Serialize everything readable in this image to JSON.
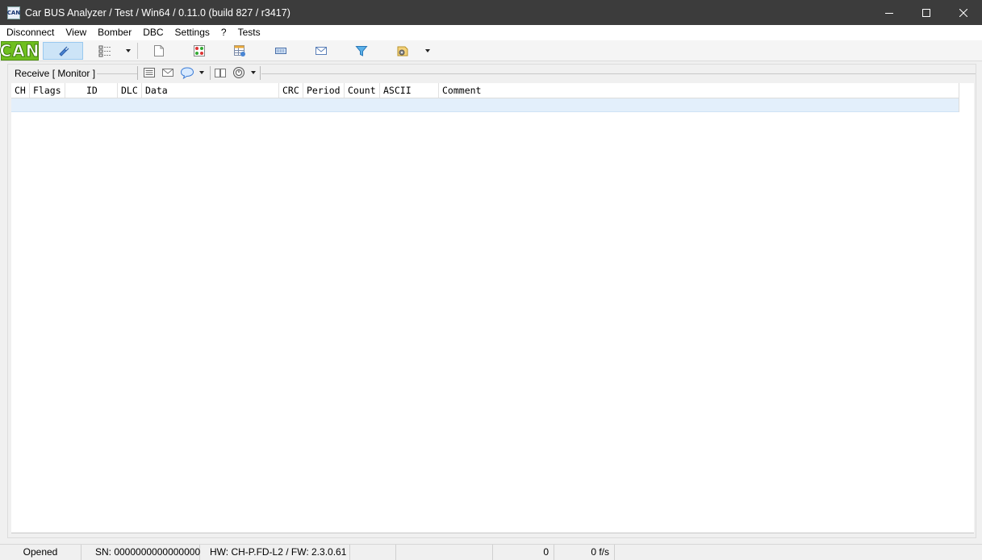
{
  "window": {
    "title": "Car BUS Analyzer / Test / Win64 / 0.11.0 (build 827 / r3417)",
    "app_icon_text": "CAN"
  },
  "menu": [
    "Disconnect",
    "View",
    "Bomber",
    "DBC",
    "Settings",
    "?",
    "Tests"
  ],
  "toolbar": {
    "logo_text": "CAN",
    "icons": [
      "connect-plug-icon",
      "tree-view-icon",
      "new-document-icon",
      "bomber-grid-icon",
      "dbc-table-icon",
      "transmit-icon",
      "message-envelope-icon",
      "filter-icon",
      "settings-icon"
    ],
    "accent": "#cce4f7",
    "logo_color": "#6fbf1f"
  },
  "receive": {
    "title": "Receive [ Monitor ]",
    "toolbar_icons": [
      "list-icon",
      "envelope-icon",
      "comment-bubble-icon",
      "book-icon",
      "clock-icon"
    ],
    "columns": [
      "CH",
      "Flags",
      "ID",
      "DLC",
      "Data",
      "CRC",
      "Period",
      "Count",
      "ASCII",
      "Comment"
    ],
    "row_color": "#e3effb"
  },
  "status": {
    "state": "Opened",
    "serial": "SN: 0000000000000000",
    "hw_fw": "HW: CH-P.FD-L2 / FW: 2.3.0.61",
    "count": "0",
    "rate": "0 f/s"
  }
}
